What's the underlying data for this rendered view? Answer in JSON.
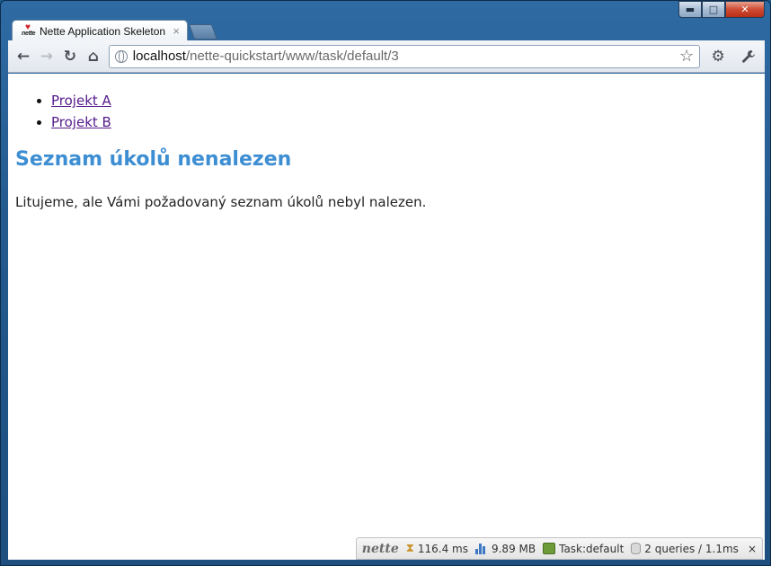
{
  "window": {
    "controls": {
      "minimize": "▬",
      "maximize": "□",
      "close": "✕"
    }
  },
  "tab": {
    "title": "Nette Application Skeleton",
    "close": "×",
    "favicon_text": "nette"
  },
  "toolbar": {
    "back_icon": "←",
    "forward_icon": "→",
    "reload_icon": "↻",
    "home_icon": "⌂",
    "url_host": "localhost",
    "url_path": "/nette-quickstart/www/task/default/3",
    "bookmark_icon": "☆",
    "settings_icon": "⚙",
    "wrench_icon": "🔧"
  },
  "content": {
    "projects": [
      "Projekt A",
      "Projekt B"
    ],
    "title": "Seznam úkolů nenalezen",
    "message": "Litujeme, ale Vámi požadovaný seznam úkolů nebyl nalezen."
  },
  "debugbar": {
    "logo": "nette",
    "time": "116.4 ms",
    "memory": "9.89 MB",
    "presenter": "Task:default",
    "queries": "2 queries / 1.1ms",
    "close": "×"
  },
  "colors": {
    "title_blue": "#3d8ed2",
    "link_visited": "#551a8b",
    "frame_blue": "#245a8e"
  }
}
